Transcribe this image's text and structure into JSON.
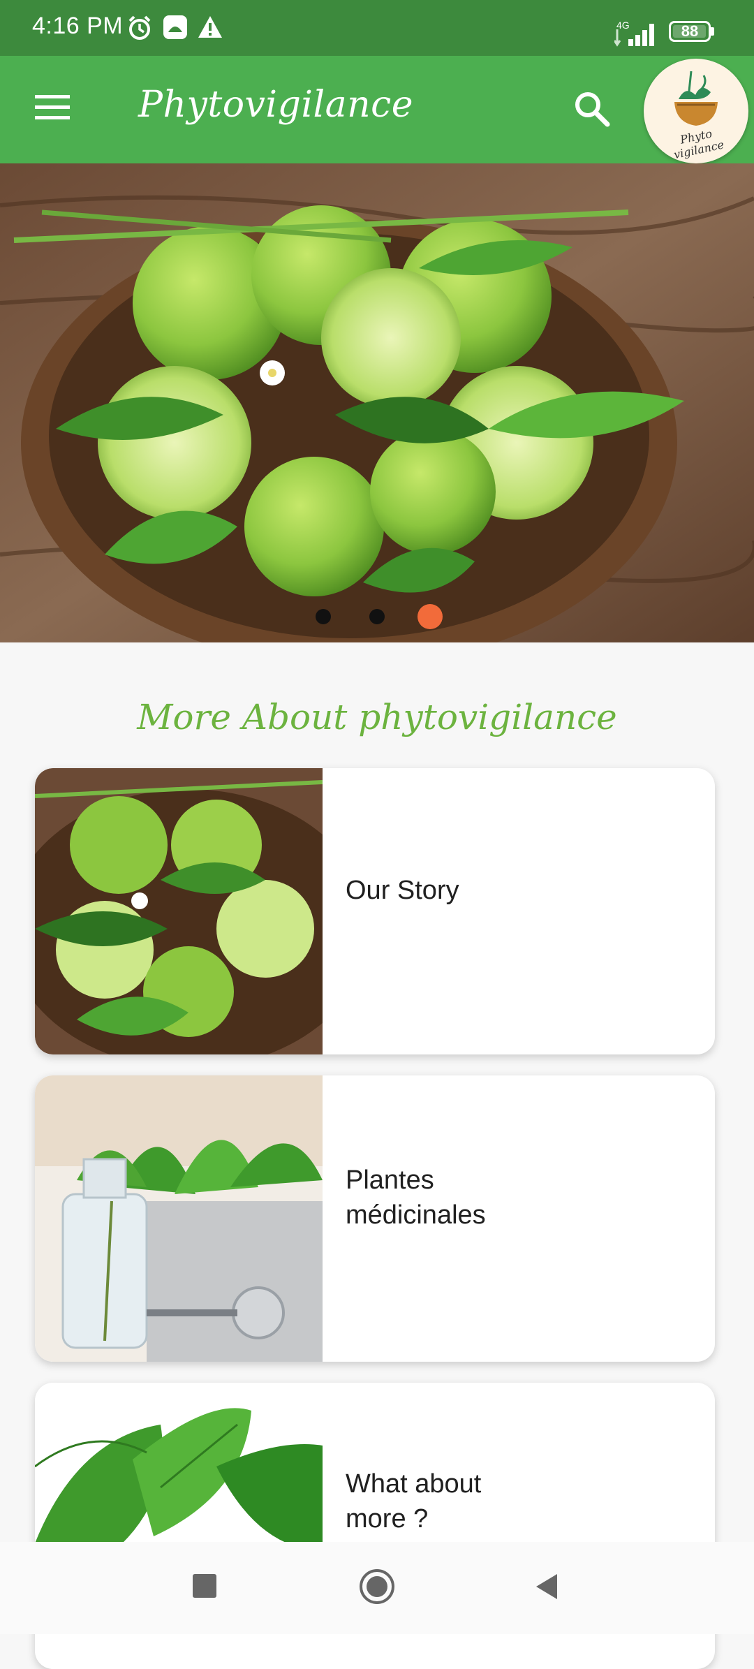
{
  "status_bar": {
    "time": "4:16 PM",
    "network": "4G",
    "battery": "88",
    "icons": [
      "alarm-icon",
      "app-notification-icon",
      "warning-icon",
      "signal-icon",
      "battery-icon"
    ]
  },
  "app_bar": {
    "title": "Phytovigilance",
    "logo_text": "Phyto vigilance",
    "colors": {
      "status": "#3d8a3d",
      "app_bar": "#4caf50"
    }
  },
  "carousel": {
    "image": "lime-mint-bowl",
    "dot_count": 3,
    "active_index": 2,
    "colors": {
      "dot": "#111111",
      "active_dot": "#f26b3a"
    }
  },
  "section": {
    "title": "More About phytovigilance"
  },
  "cards": [
    {
      "label": "Our Story",
      "image": "lime-mint-bowl"
    },
    {
      "label": "Plantes médicinales",
      "image": "herbs-bottles-stethoscope"
    },
    {
      "label": "What about more ?",
      "image": "green-leaves"
    }
  ],
  "nav_bar": {
    "buttons": [
      "recents-button",
      "home-button",
      "back-button"
    ]
  }
}
